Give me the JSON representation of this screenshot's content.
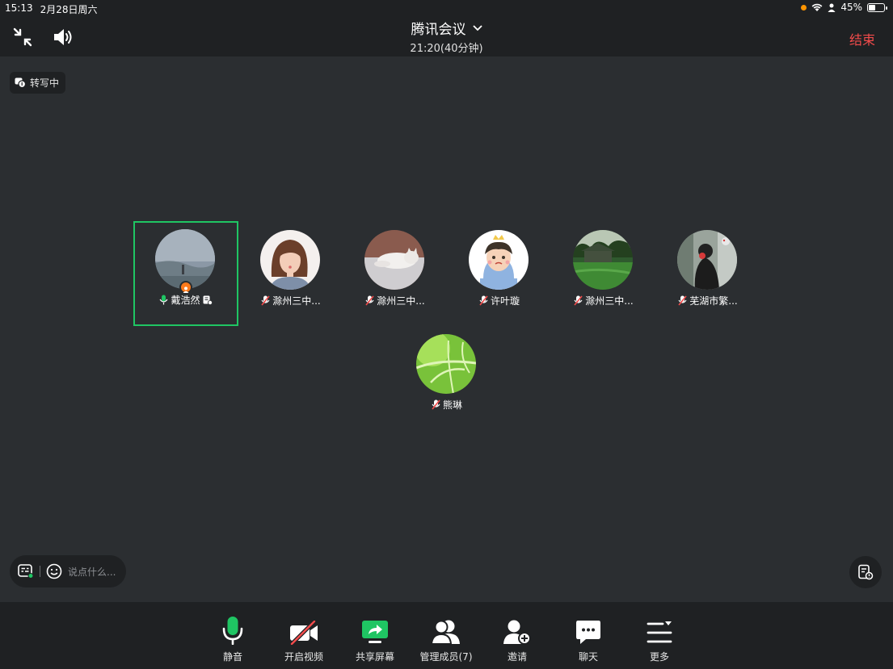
{
  "status_bar": {
    "time": "15:13",
    "date": "2月28日周六",
    "battery_percent": "45%",
    "battery_level": 0.45
  },
  "header": {
    "title": "腾讯会议",
    "subtitle": "21:20(40分钟)",
    "end_label": "结束"
  },
  "transcribe_chip": {
    "label": "转写中"
  },
  "participants": [
    {
      "name": "戴浩然",
      "speaking": true,
      "host": true
    },
    {
      "name": "滁州三中...",
      "muted": true
    },
    {
      "name": "滁州三中...",
      "muted": true
    },
    {
      "name": "许叶璇",
      "muted": true
    },
    {
      "name": "滁州三中...",
      "muted": true
    },
    {
      "name": "芜湖市繁...",
      "muted": true
    },
    {
      "name": "熊琳",
      "muted": true
    }
  ],
  "chat": {
    "placeholder": "说点什么..."
  },
  "toolbar": {
    "mute": "静音",
    "video": "开启视频",
    "share": "共享屏幕",
    "members": "管理成员(7)",
    "invite": "邀请",
    "chat": "聊天",
    "more": "更多"
  },
  "colors": {
    "accent_green": "#1fc563",
    "end_red": "#f24b4b",
    "host_orange": "#ff7a1a"
  }
}
